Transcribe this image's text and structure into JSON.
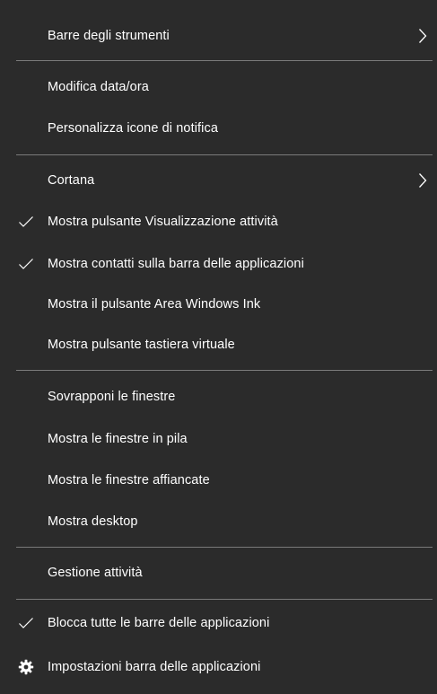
{
  "colors": {
    "background": "#2b2b2b",
    "text": "#ffffff",
    "separator": "#7a7a7a"
  },
  "menu": {
    "toolbars": "Barre degli strumenti",
    "adjust_datetime": "Modifica data/ora",
    "customize_notification_icons": "Personalizza icone di notifica",
    "cortana": "Cortana",
    "show_task_view": "Mostra pulsante Visualizzazione attività",
    "show_people": "Mostra contatti sulla barra delle applicazioni",
    "show_ink_workspace": "Mostra il pulsante Area Windows Ink",
    "show_touch_keyboard": "Mostra pulsante tastiera virtuale",
    "cascade_windows": "Sovrapponi le finestre",
    "stacked_windows": "Mostra le finestre in pila",
    "side_by_side_windows": "Mostra le finestre affiancate",
    "show_desktop": "Mostra desktop",
    "task_manager": "Gestione attività",
    "lock_taskbars": "Blocca tutte le barre delle applicazioni",
    "taskbar_settings": "Impostazioni barra delle applicazioni"
  },
  "checked": {
    "show_task_view": true,
    "show_people": true,
    "lock_taskbars": true
  },
  "icons": {
    "submenu_arrow": "chevron-right-icon",
    "checkmark": "checkmark-icon",
    "settings": "gear-icon"
  }
}
